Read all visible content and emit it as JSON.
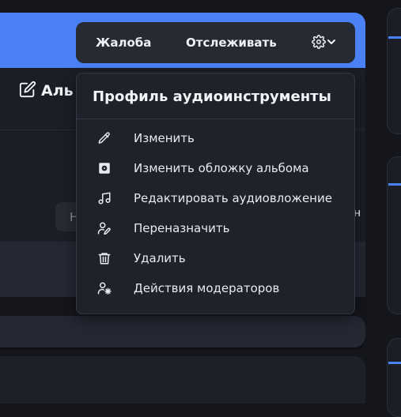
{
  "album_header": {
    "title_fragment": "Аль"
  },
  "background": {
    "pill_text": "Н",
    "edge_mark": "н"
  },
  "action_bar": {
    "report_label": "Жалоба",
    "follow_label": "Отслеживать",
    "settings_icon": "gear-icon",
    "chevron_icon": "chevron-down-icon"
  },
  "menu": {
    "title": "Профиль аудиоинструменты",
    "items": [
      {
        "label": "Изменить",
        "icon": "pencil-icon"
      },
      {
        "label": "Изменить обложку альбома",
        "icon": "album-cover-icon"
      },
      {
        "label": "Редактировать аудиовложение",
        "icon": "music-note-icon"
      },
      {
        "label": "Переназначить",
        "icon": "user-edit-icon"
      },
      {
        "label": "Удалить",
        "icon": "trash-icon"
      },
      {
        "label": "Действия модераторов",
        "icon": "user-gear-icon"
      }
    ]
  },
  "colors": {
    "accent": "#4a82f5",
    "page_bg": "#14161c",
    "panel_bg": "#1f222b",
    "bar_bg": "#262a33",
    "text": "#e8eaf0"
  }
}
